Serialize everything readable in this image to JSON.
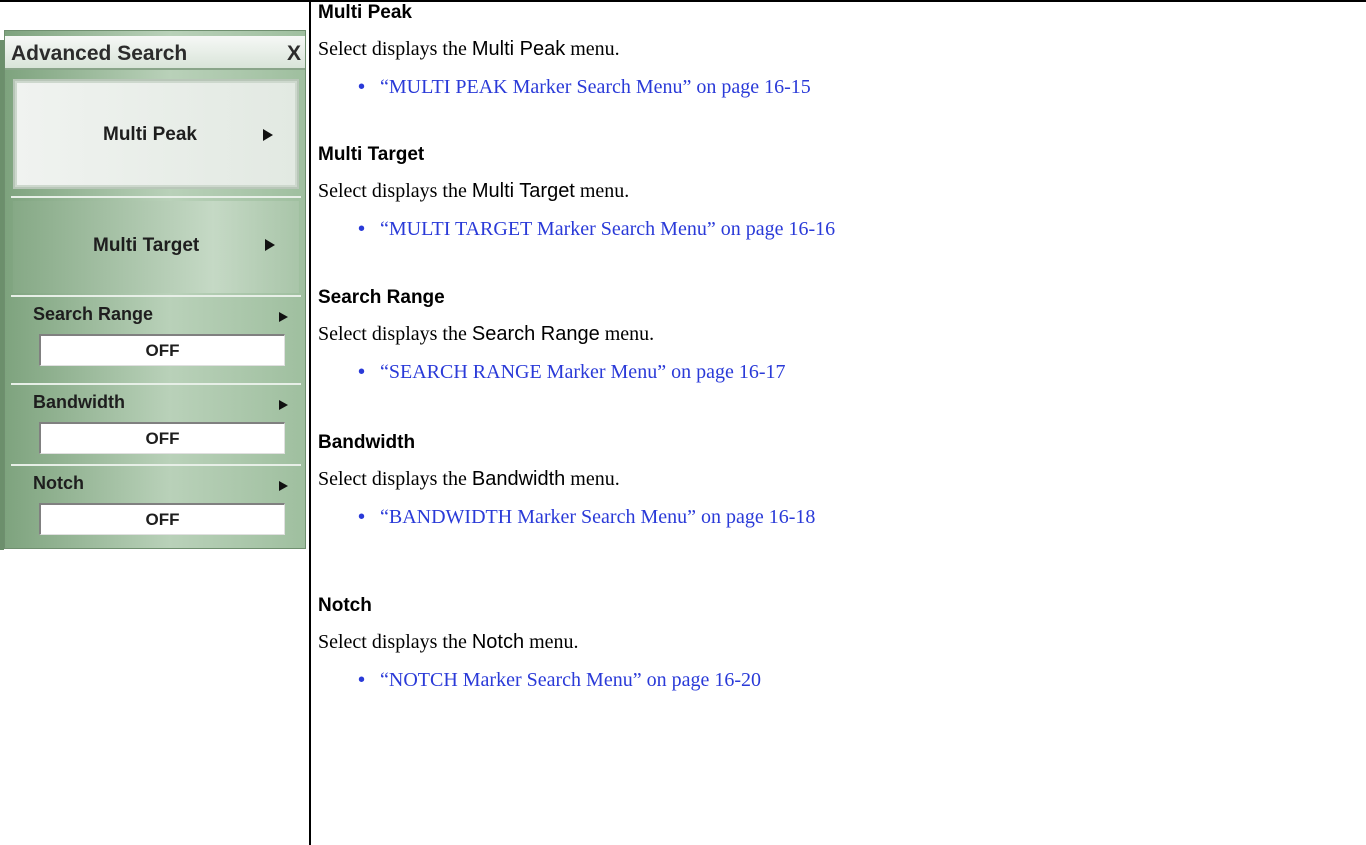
{
  "menu": {
    "title": "Advanced Search",
    "close_label": "X",
    "buttons": [
      {
        "label": "Multi Peak"
      },
      {
        "label": "Multi Target"
      }
    ],
    "settings": [
      {
        "label": "Search Range",
        "value": "OFF"
      },
      {
        "label": "Bandwidth",
        "value": "OFF"
      },
      {
        "label": "Notch",
        "value": "OFF"
      }
    ]
  },
  "sections": [
    {
      "heading": "Multi Peak",
      "desc_prefix": "Select displays the ",
      "desc_ui": "Multi Peak",
      "desc_suffix": " menu.",
      "link": "“MULTI PEAK Marker Search Menu” on page 16-15"
    },
    {
      "heading": "Multi Target",
      "desc_prefix": "Select displays the ",
      "desc_ui": "Multi Target",
      "desc_suffix": " menu.",
      "link": "“MULTI TARGET Marker Search Menu” on page 16-16"
    },
    {
      "heading": "Search Range",
      "desc_prefix": "Select displays the ",
      "desc_ui": "Search Range",
      "desc_suffix": " menu.",
      "link": "“SEARCH RANGE Marker Menu” on page 16-17"
    },
    {
      "heading": "Bandwidth",
      "desc_prefix": "Select displays the ",
      "desc_ui": "Bandwidth",
      "desc_suffix": " menu.",
      "link": "“BANDWIDTH Marker Search Menu” on page 16-18"
    },
    {
      "heading": "Notch",
      "desc_prefix": "Select displays the ",
      "desc_ui": "Notch",
      "desc_suffix": " menu.",
      "link": "“NOTCH Marker Search Menu” on page 16-20"
    }
  ],
  "bullet_char": "•"
}
